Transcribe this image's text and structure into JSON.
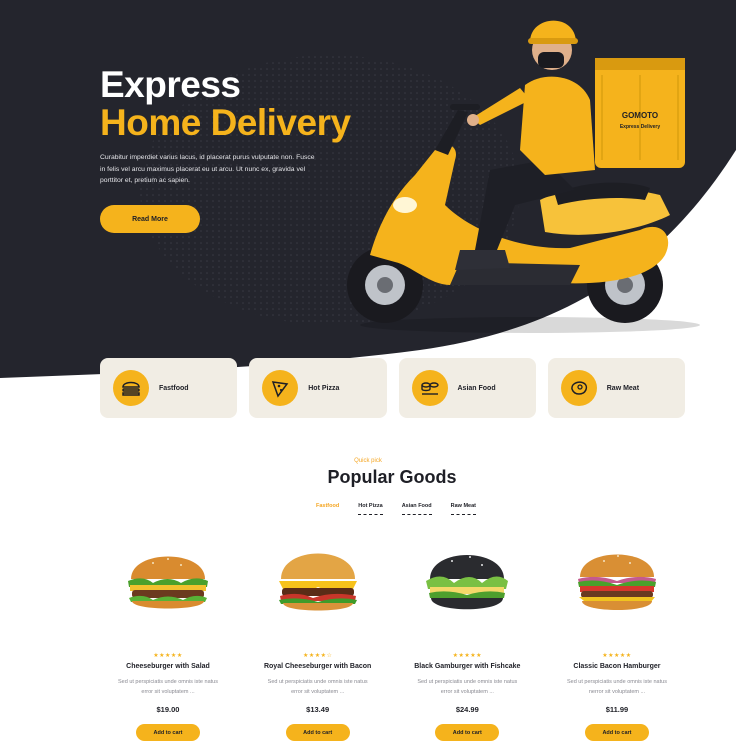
{
  "hero": {
    "title_line1": "Express",
    "title_line2": "Home Delivery",
    "description": "Curabitur imperdiet varius lacus, id placerat purus vulputate non. Fusce in felis vel arcu maximus placerat eu ut arcu. Ut nunc ex, gravida vel porttitor et, pretium ac sapien.",
    "button_label": "Read More",
    "bag_brand": "GOMOTO",
    "bag_tagline": "Express Delivery"
  },
  "categories": [
    {
      "label": "Fastfood",
      "icon": "burger-icon"
    },
    {
      "label": "Hot Pizza",
      "icon": "pizza-icon"
    },
    {
      "label": "Asian Food",
      "icon": "sushi-icon"
    },
    {
      "label": "Raw Meat",
      "icon": "meat-icon"
    }
  ],
  "popular": {
    "subtitle": "Quick pick",
    "title": "Popular Goods",
    "tabs": [
      "Fastfood",
      "Hot Pizza",
      "Asian Food",
      "Raw Meat"
    ],
    "active_tab": "Fastfood"
  },
  "products": [
    {
      "name": "Cheeseburger with Salad",
      "desc": "Sed ut perspiciatis unde omnis iste natus error sit voluptatem ...",
      "price": "$19.00",
      "button": "Add to cart",
      "stars": "★★★★★"
    },
    {
      "name": "Royal Cheeseburger with Bacon",
      "desc": "Sed ut perspiciatis unde omnis iste natus error sit voluptatem ...",
      "price": "$13.49",
      "button": "Add to cart",
      "stars": "★★★★☆"
    },
    {
      "name": "Black Gamburger with Fishcake",
      "desc": "Sed ut perspiciatis unde omnis iste natus error sit voluptatem ...",
      "price": "$24.99",
      "button": "Add to cart",
      "stars": "★★★★★"
    },
    {
      "name": "Classic Bacon Hamburger",
      "desc": "Sed ut perspiciatis unde omnis iste natus nerror sit voluptatem ...",
      "price": "$11.99",
      "button": "Add to cart",
      "stars": "★★★★★"
    }
  ],
  "colors": {
    "accent": "#f5b31c",
    "dark": "#24252d",
    "card_bg": "#f1ede4"
  }
}
